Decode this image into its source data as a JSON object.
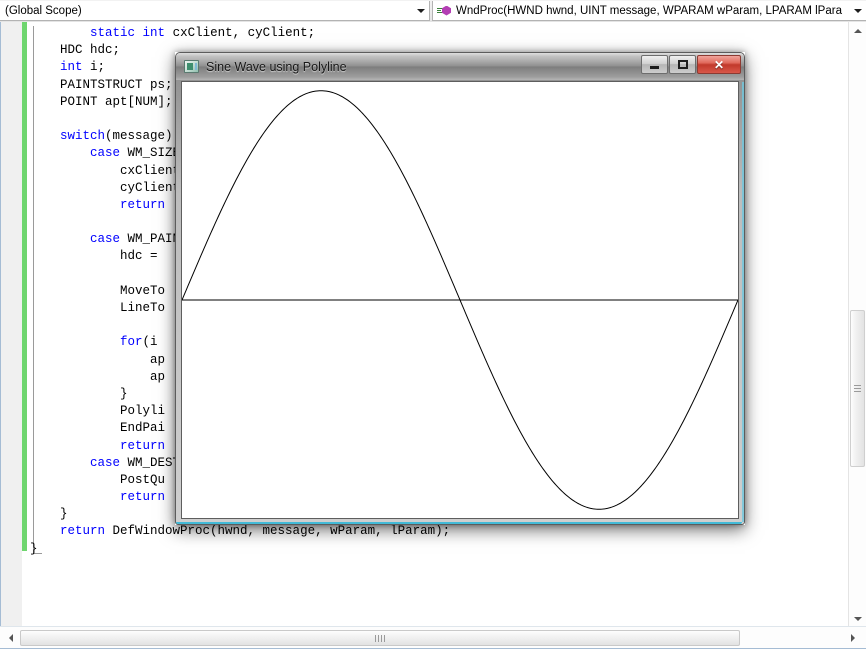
{
  "navbar": {
    "scope": {
      "value": "(Global Scope)",
      "arrow_icon": "chevron-down-icon"
    },
    "function": {
      "value": "WndProc(HWND hwnd, UINT message, WPARAM wParam, LPARAM lPara",
      "icon": "method-icon",
      "arrow_icon": "chevron-down-icon"
    }
  },
  "editor": {
    "lines": [
      {
        "indent": 8,
        "text": "static int cxClient, cyClient;",
        "kw": [
          "static",
          "int"
        ]
      },
      {
        "indent": 4,
        "text": "HDC hdc;",
        "kw": []
      },
      {
        "indent": 4,
        "text": "int i;",
        "kw": [
          "int"
        ]
      },
      {
        "indent": 4,
        "text": "PAINTSTRUCT ps;",
        "kw": []
      },
      {
        "indent": 4,
        "text": "POINT apt[NUM];",
        "kw": []
      },
      {
        "indent": 0,
        "text": "",
        "kw": []
      },
      {
        "indent": 4,
        "text": "switch(message)",
        "kw": [
          "switch"
        ]
      },
      {
        "indent": 8,
        "text": "case WM_SIZE:",
        "kw": [
          "case"
        ]
      },
      {
        "indent": 12,
        "text": "cxClient",
        "kw": []
      },
      {
        "indent": 12,
        "text": "cyClient",
        "kw": []
      },
      {
        "indent": 12,
        "text": "return",
        "kw": [
          "return"
        ]
      },
      {
        "indent": 0,
        "text": "",
        "kw": []
      },
      {
        "indent": 8,
        "text": "case WM_PAINT:",
        "kw": [
          "case"
        ]
      },
      {
        "indent": 12,
        "text": "hdc =",
        "kw": []
      },
      {
        "indent": 0,
        "text": "",
        "kw": []
      },
      {
        "indent": 12,
        "text": "MoveTo",
        "kw": []
      },
      {
        "indent": 12,
        "text": "LineTo",
        "kw": []
      },
      {
        "indent": 0,
        "text": "",
        "kw": []
      },
      {
        "indent": 12,
        "text": "for(i",
        "kw": [
          "for"
        ]
      },
      {
        "indent": 16,
        "text": "ap",
        "kw": []
      },
      {
        "indent": 16,
        "text": "ap",
        "kw": []
      },
      {
        "indent": 12,
        "text": "}",
        "kw": []
      },
      {
        "indent": 12,
        "text": "Polyli",
        "kw": []
      },
      {
        "indent": 12,
        "text": "EndPai",
        "kw": []
      },
      {
        "indent": 12,
        "text": "return",
        "kw": [
          "return"
        ]
      },
      {
        "indent": 8,
        "text": "case WM_DESTROY:",
        "kw": [
          "case"
        ]
      },
      {
        "indent": 12,
        "text": "PostQu",
        "kw": []
      },
      {
        "indent": 12,
        "text": "return",
        "kw": [
          "return"
        ]
      },
      {
        "indent": 4,
        "text": "}",
        "kw": []
      },
      {
        "indent": 4,
        "text": "return DefWindowProc(hwnd, message, wParam, lParam);",
        "kw": [
          "return"
        ]
      },
      {
        "indent": 0,
        "text": "}",
        "kw": []
      }
    ]
  },
  "child_window": {
    "title": "Sine Wave using Polyline",
    "icon": "app-window-icon",
    "buttons": {
      "minimize": {
        "name": "minimize-button",
        "glyph": "minimize-icon"
      },
      "maximize": {
        "name": "maximize-button",
        "glyph": "maximize-icon"
      },
      "close": {
        "name": "close-button",
        "glyph": "✕"
      }
    },
    "drawing": {
      "type": "sine-wave-polyline",
      "cycles": 1,
      "baseline_ratio": 0.5,
      "amplitude_ratio": 0.47,
      "stroke_color": "#000000",
      "background": "#ffffff",
      "axis_line": true
    }
  },
  "scrollbars": {
    "vertical": {
      "up_icon": "triangle-up-icon",
      "down_icon": "triangle-down-icon",
      "thumb_top_pct": 48,
      "thumb_size_pct": 26
    },
    "horizontal": {
      "left_icon": "triangle-left-icon",
      "right_icon": "triangle-right-icon",
      "thumb_left_pct": 2,
      "thumb_size_pct": 84
    }
  },
  "colors": {
    "keyword": "#0000ff",
    "text": "#000000",
    "change_bar": "#6fd66f",
    "window_accent": "#29b6d8",
    "close_button": "#c1392b"
  }
}
